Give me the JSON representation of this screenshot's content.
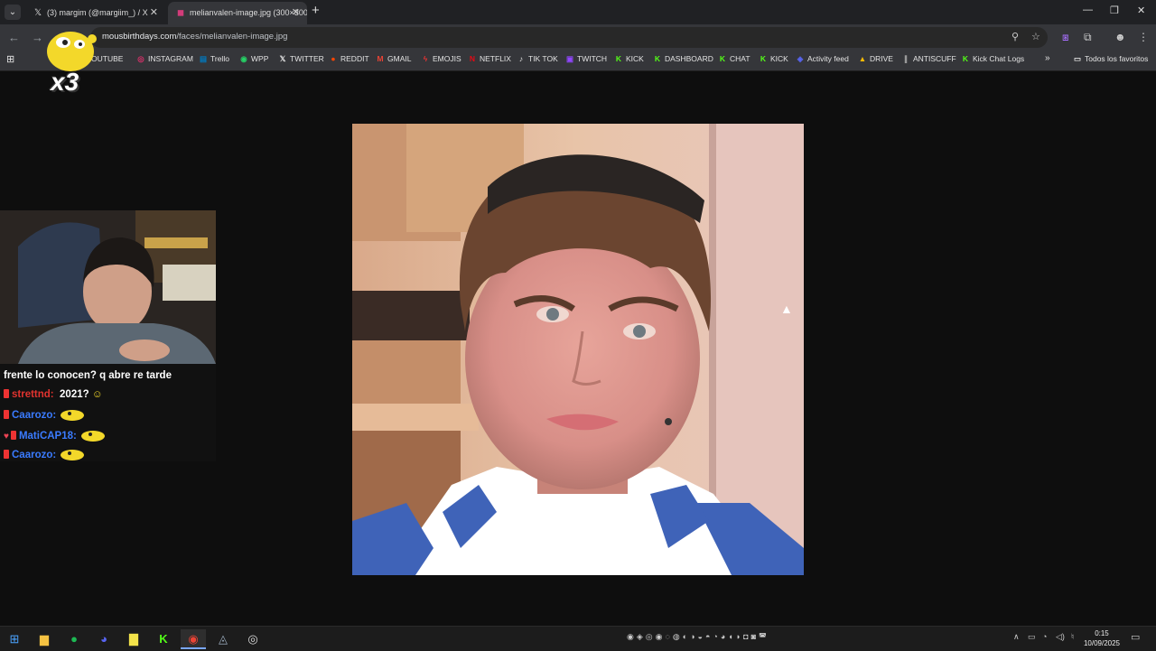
{
  "browser": {
    "tabs": [
      {
        "title": "(3) margim (@margiim_) / X",
        "icon": "x-icon"
      },
      {
        "title": "melianvalen-image.jpg (300×300)",
        "icon": "favicon"
      }
    ],
    "url_host": "mousbirthdays.com",
    "url_path": "/faces/melianvalen-image.jpg"
  },
  "bookmarks": [
    {
      "label": "OUTUBE",
      "icon": "youtube-icon",
      "color": "#ff0000"
    },
    {
      "label": "INSTAGRAM",
      "icon": "instagram-icon",
      "color": "#e1306c"
    },
    {
      "label": "Trello",
      "icon": "trello-icon",
      "color": "#0079bf"
    },
    {
      "label": "WPP",
      "icon": "whatsapp-icon",
      "color": "#25d366"
    },
    {
      "label": "TWITTER",
      "icon": "x-icon",
      "color": "#ffffff"
    },
    {
      "label": "REDDIT",
      "icon": "reddit-icon",
      "color": "#ff4500"
    },
    {
      "label": "GMAIL",
      "icon": "gmail-icon",
      "color": "#ea4335"
    },
    {
      "label": "EMOJIS",
      "icon": "emoji-icon",
      "color": "#e33"
    },
    {
      "label": "NETFLIX",
      "icon": "netflix-icon",
      "color": "#e50914"
    },
    {
      "label": "TIK TOK",
      "icon": "tiktok-icon",
      "color": "#ffffff"
    },
    {
      "label": "TWITCH",
      "icon": "twitch-icon",
      "color": "#9146ff"
    },
    {
      "label": "KICK",
      "icon": "kick-icon",
      "color": "#53fc18"
    },
    {
      "label": "DASHBOARD",
      "icon": "kick-icon",
      "color": "#53fc18"
    },
    {
      "label": "CHAT",
      "icon": "kick-icon",
      "color": "#53fc18"
    },
    {
      "label": "KICK",
      "icon": "kick-icon",
      "color": "#53fc18"
    },
    {
      "label": "Activity feed",
      "icon": "activity-icon",
      "color": "#5865f2"
    },
    {
      "label": "DRIVE",
      "icon": "drive-icon",
      "color": "#fbbc04"
    },
    {
      "label": "ANTISCUFF",
      "icon": "antiscuff-icon",
      "color": "#aaaaaa"
    },
    {
      "label": "Kick Chat Logs",
      "icon": "kick-icon",
      "color": "#53fc18"
    }
  ],
  "bookmarks_more": "»",
  "all_bookmarks": "Todos los favoritos",
  "overlay": {
    "multiplier": "x3"
  },
  "chat": {
    "messages": [
      {
        "user": "",
        "text": "frente lo conocen? q abre re tarde",
        "user_color": "#ffffff"
      },
      {
        "user": "strettnd:",
        "text": "2021?",
        "user_color": "#e0332f"
      },
      {
        "user": "Caarozo:",
        "text": "",
        "user_color": "#3a7bff"
      },
      {
        "user": "MatiCAP18:",
        "text": "",
        "user_color": "#3a7bff"
      },
      {
        "user": "Caarozo:",
        "text": "",
        "user_color": "#3a7bff"
      }
    ]
  },
  "taskbar": {
    "time": "0:15",
    "date": "10/09/2025"
  }
}
